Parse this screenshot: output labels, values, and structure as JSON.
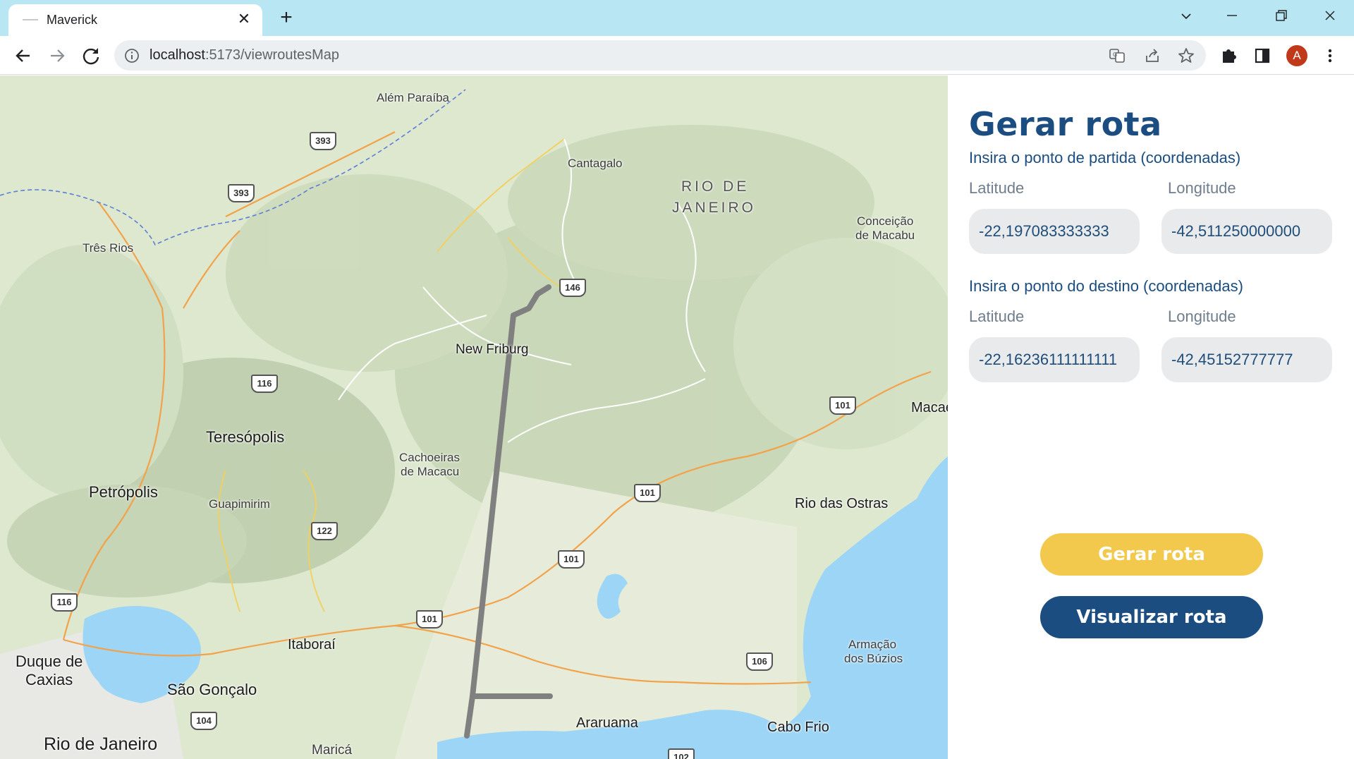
{
  "browser": {
    "tab_title": "Maverick",
    "url_host": "localhost",
    "url_path": ":5173/viewroutesMap",
    "avatar_letter": "A"
  },
  "map": {
    "places": [
      {
        "name": "Além Paraíba",
        "kind": "town"
      },
      {
        "name": "Cantagalo",
        "kind": "town"
      },
      {
        "name": "RIO DE",
        "kind": "state"
      },
      {
        "name": "JANEIRO",
        "kind": "state"
      },
      {
        "name": "Conceição",
        "kind": "town"
      },
      {
        "name": "de Macabu",
        "kind": "town"
      },
      {
        "name": "Três Rios",
        "kind": "town"
      },
      {
        "name": "New Friburg",
        "kind": "town"
      },
      {
        "name": "Teresópolis",
        "kind": "city"
      },
      {
        "name": "Cachoeiras",
        "kind": "town"
      },
      {
        "name": "de Macacu",
        "kind": "town"
      },
      {
        "name": "Petrópolis",
        "kind": "city"
      },
      {
        "name": "Guapimirim",
        "kind": "town"
      },
      {
        "name": "Rio das Ostras",
        "kind": "city"
      },
      {
        "name": "Macaé",
        "kind": "town"
      },
      {
        "name": "Itaboraí",
        "kind": "city"
      },
      {
        "name": "Duque de",
        "kind": "city"
      },
      {
        "name": "Caxias",
        "kind": "city"
      },
      {
        "name": "São Gonçalo",
        "kind": "city"
      },
      {
        "name": "Armação",
        "kind": "town"
      },
      {
        "name": "dos Búzios",
        "kind": "town"
      },
      {
        "name": "Araruama",
        "kind": "city"
      },
      {
        "name": "Cabo Frio",
        "kind": "city"
      },
      {
        "name": "Rio de Janeiro",
        "kind": "city"
      },
      {
        "name": "Maricá",
        "kind": "town"
      }
    ],
    "shields": [
      "393",
      "393",
      "146",
      "116",
      "101",
      "101",
      "101",
      "122",
      "116",
      "101",
      "106",
      "104",
      "102"
    ]
  },
  "panel": {
    "title": "Gerar rota",
    "start_section": "Insira o ponto de partida (coordenadas)",
    "dest_section": "Insira o ponto do destino (coordenadas)",
    "lat_label": "Latitude",
    "lng_label": "Longitude",
    "start_lat": "-22,197083333333",
    "start_lng": "-42,511250000000",
    "dest_lat": "-22,16236111111111",
    "dest_lng": "-42,45152777777",
    "generate_button": "Gerar rota",
    "view_button": "Visualizar rota"
  },
  "colors": {
    "panel_accent": "#1b4d80",
    "generate_button": "#f2c94c",
    "route_line": "#808080",
    "water": "#9cd5f5"
  }
}
